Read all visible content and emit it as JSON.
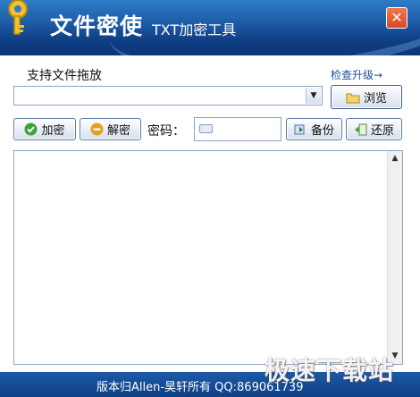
{
  "app": {
    "title": "文件密使",
    "subtitle": "TXT加密工具",
    "close_label": "✕"
  },
  "file_area": {
    "drag_label": "支持文件拖放",
    "upgrade_link": "检查升级→",
    "path_value": "",
    "browse_label": "浏览"
  },
  "toolbar": {
    "encrypt_label": "加密",
    "decrypt_label": "解密",
    "password_label": "密码：",
    "password_value": "",
    "backup_label": "备份",
    "restore_label": "还原"
  },
  "content": {
    "text": ""
  },
  "footer": {
    "copyright": "版本归Allen-昊轩所有  QQ:869061739"
  },
  "watermark": {
    "text": "极速下载站"
  },
  "icons": {
    "app": "key-icon",
    "close": "close-icon",
    "browse": "folder-icon",
    "encrypt": "check-icon",
    "decrypt": "minus-icon",
    "keyboard": "keyboard-icon",
    "backup": "backup-icon",
    "restore": "restore-icon"
  },
  "colors": {
    "titlebar": "#1f5ea8",
    "statusbar": "#0f3f86",
    "button_border": "#5a7aa8",
    "encrypt_icon": "#3fa33b",
    "decrypt_icon": "#e1a21e",
    "close_button": "#d9452a"
  }
}
